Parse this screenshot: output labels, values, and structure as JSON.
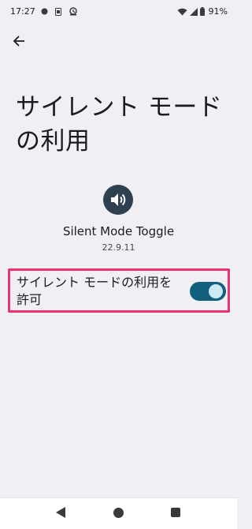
{
  "status_bar": {
    "time": "17:27",
    "battery": "91%",
    "icons": [
      "record-icon",
      "sim-icon",
      "vpn-icon",
      "wifi-icon",
      "signal-icon",
      "battery-icon"
    ]
  },
  "header": {
    "back_icon": "arrow-back-icon",
    "title": "サイレント モードの利用"
  },
  "app": {
    "icon": "speaker-icon",
    "name": "Silent Mode Toggle",
    "version": "22.9.11"
  },
  "permission": {
    "label": "サイレント モードの利用を許可",
    "enabled": true,
    "highlight_color": "#e8336e"
  },
  "colors": {
    "toggle_track": "#12607e",
    "toggle_thumb": "#cde8f6",
    "background": "#f0eff3"
  },
  "nav_bar": {
    "icons": [
      "nav-back-icon",
      "nav-home-icon",
      "nav-recents-icon"
    ]
  }
}
